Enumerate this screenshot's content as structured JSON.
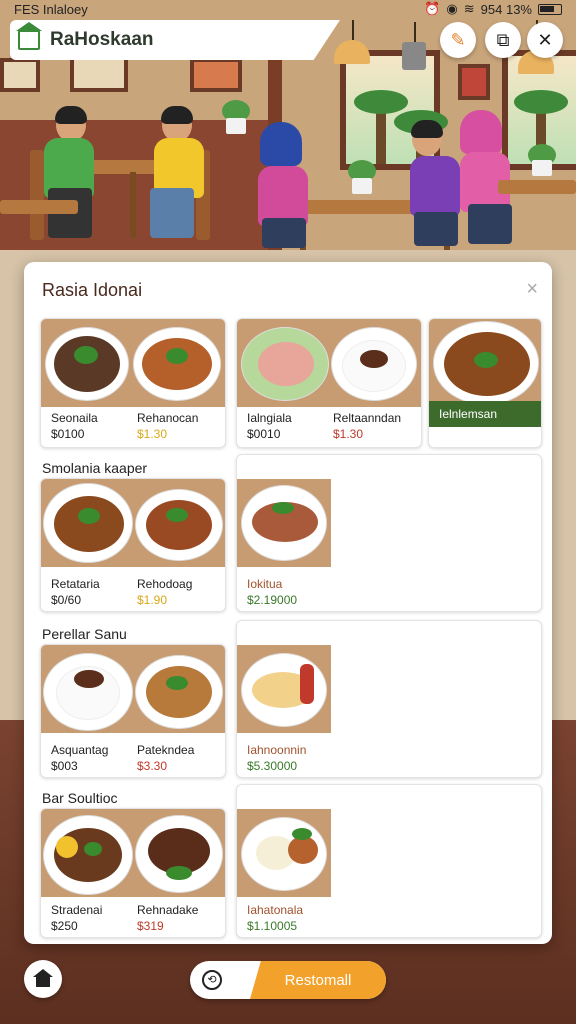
{
  "status_bar": {
    "left_text": "FES Inlaloey",
    "right_text": "954 13%"
  },
  "header": {
    "title": "RaHoskaan"
  },
  "icons": {
    "home_outline": "home-outline-icon",
    "brush": "brush-icon",
    "share": "share-icon",
    "close": "close-icon"
  },
  "panel": {
    "title": "Rasia Idonai",
    "close_glyph": "×",
    "sections": [
      {
        "title": "",
        "cards": [
          {
            "items": [
              {
                "name": "Seonaila",
                "price": "$0100",
                "price_color": "default"
              },
              {
                "name": "Rehanocan",
                "price": "$1.30",
                "price_color": "yellow"
              }
            ]
          },
          {
            "items": [
              {
                "name": "Ialngiala",
                "price": "$0010",
                "price_color": "default"
              },
              {
                "name": "Reltaanndan",
                "price": "$1.30",
                "price_color": "red"
              }
            ]
          },
          {
            "banner": "Ielnlemsan"
          }
        ]
      },
      {
        "title": "Smolania kaaper",
        "cards": [
          {
            "items": [
              {
                "name": "Retataria",
                "price": "$0/60",
                "price_color": "default"
              },
              {
                "name": "Rehodoag",
                "price": "$1.90",
                "price_color": "yellow"
              }
            ]
          },
          {
            "items": [
              {
                "name": "Iokitua",
                "price": "$2.19000",
                "price_color": "green"
              }
            ]
          }
        ]
      },
      {
        "title": "Perellar Sanu",
        "cards": [
          {
            "items": [
              {
                "name": "Asquantag",
                "price": "$003",
                "price_color": "default"
              },
              {
                "name": "Patekndea",
                "price": "$3.30",
                "price_color": "red"
              }
            ]
          },
          {
            "items": [
              {
                "name": "Iahnoonnin",
                "price": "$5.30000",
                "price_color": "green"
              }
            ]
          }
        ]
      },
      {
        "title": "Bar Soultioc",
        "cards": [
          {
            "items": [
              {
                "name": "Stradenai",
                "price": "$250",
                "price_color": "default"
              },
              {
                "name": "Rehnadake",
                "price": "$319",
                "price_color": "red"
              }
            ]
          },
          {
            "items": [
              {
                "name": "Iahatonala",
                "price": "$1.10005",
                "price_color": "green"
              }
            ]
          }
        ]
      }
    ]
  },
  "bottom": {
    "action_label": "Restomall",
    "action_icon_glyph": "⟲"
  },
  "colors": {
    "accent_orange": "#f2a12a",
    "brand_green": "#3a8a3a",
    "panel_title": "#4a2a1e"
  }
}
